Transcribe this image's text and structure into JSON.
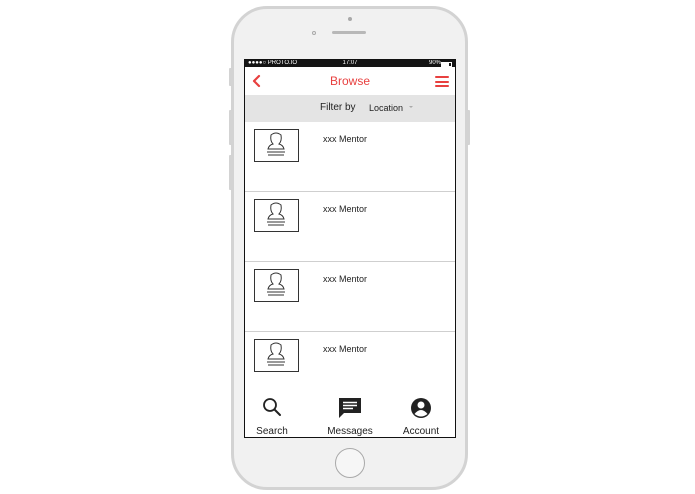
{
  "status_bar": {
    "carrier": "●●●●○ PROTO.IO",
    "time": "17:07",
    "battery": "90%"
  },
  "nav": {
    "title": "Browse"
  },
  "filter": {
    "label": "Filter by",
    "value": "Location"
  },
  "list": {
    "items": [
      {
        "label": "xxx Mentor"
      },
      {
        "label": "xxx Mentor"
      },
      {
        "label": "xxx Mentor"
      },
      {
        "label": "xxx Mentor"
      }
    ]
  },
  "tabs": [
    {
      "label": "Search",
      "icon": "search-icon"
    },
    {
      "label": "Messages",
      "icon": "message-icon"
    },
    {
      "label": "Account",
      "icon": "account-icon"
    }
  ],
  "colors": {
    "accent": "#e8403f",
    "filter_bg": "#e4e4e4",
    "frame": "#d3d3d3"
  }
}
